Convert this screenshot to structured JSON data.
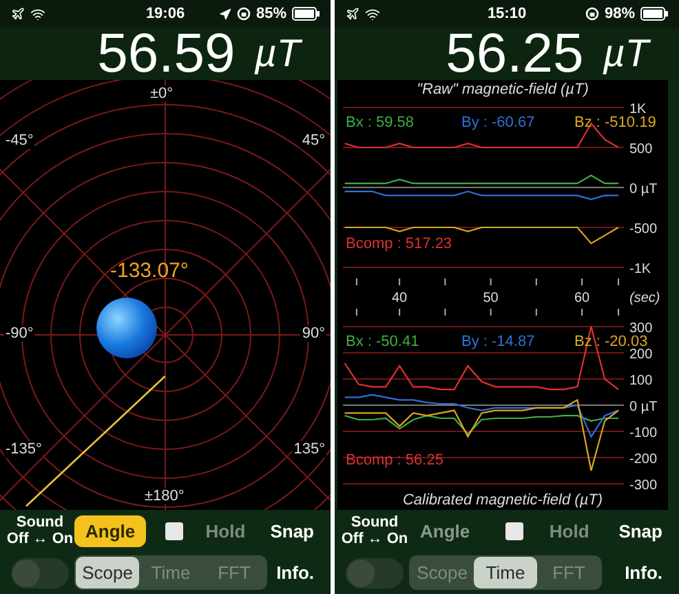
{
  "phones": [
    {
      "status": {
        "time": "19:06",
        "battery": "85%",
        "location": true
      },
      "readout": {
        "value": "56.59",
        "unit": "µT"
      },
      "display": {
        "kind": "compass",
        "labels": [
          "±0°",
          "-45°",
          "45°",
          "-90°",
          "90°",
          "-135°",
          "135°",
          "±180°"
        ],
        "heading": "-133.07°"
      },
      "controls": {
        "sound_title": "Sound",
        "sound_hint": "Off ↔ On",
        "sound_on": false,
        "buttons": [
          {
            "kind": "toggle",
            "label": "Angle",
            "selected": true
          },
          {
            "kind": "checkbox",
            "checked": false
          },
          {
            "kind": "text",
            "label": "Hold",
            "disabled": true
          },
          {
            "kind": "text",
            "label": "Snap",
            "disabled": false
          }
        ],
        "modes": [
          {
            "label": "Scope",
            "selected": true
          },
          {
            "label": "Time",
            "selected": false
          },
          {
            "label": "FFT",
            "selected": false
          }
        ],
        "info": "Info."
      }
    },
    {
      "status": {
        "time": "15:10",
        "battery": "98%",
        "location": false
      },
      "readout": {
        "value": "56.25",
        "unit": "µT"
      },
      "display": {
        "kind": "scope",
        "title_top": "\"Raw\" magnetic-field (µT)",
        "title_bottom": "Calibrated magnetic-field (µT)",
        "raw": {
          "readouts": [
            {
              "text": "Bx : 59.58",
              "color": "#3fae45"
            },
            {
              "text": "By : -60.67",
              "color": "#2f6fd8"
            },
            {
              "text": "Bz : -510.19",
              "color": "#d9a81e"
            }
          ],
          "bcomp": "Bcomp : 517.23",
          "chart_data": {
            "type": "line",
            "grid": true,
            "xlabel": "(sec)",
            "x": [
              34,
              35.5,
              37,
              38.5,
              40,
              41.5,
              43,
              44.5,
              46,
              47.5,
              49,
              50.5,
              52,
              53.5,
              55,
              56.5,
              58,
              59.5,
              61,
              62.5,
              64
            ],
            "xlim": [
              33.8,
              64.6
            ],
            "xticks": [
              40,
              50,
              60
            ],
            "ylim": [
              -1000,
              1000
            ],
            "yticks": [
              {
                "value": 1000,
                "label": "1K"
              },
              {
                "value": 500,
                "label": "500"
              },
              {
                "value": 0,
                "label": "0 µT"
              },
              {
                "value": -500,
                "label": "-500"
              },
              {
                "value": -1000,
                "label": "-1K"
              }
            ],
            "series": [
              {
                "color": "#e03030",
                "values": [
                  550,
                  500,
                  500,
                  500,
                  550,
                  500,
                  500,
                  500,
                  500,
                  550,
                  500,
                  500,
                  500,
                  500,
                  500,
                  500,
                  500,
                  500,
                  800,
                  600,
                  500
                ]
              },
              {
                "color": "#3fae45",
                "values": [
                  50,
                  50,
                  50,
                  50,
                  100,
                  50,
                  50,
                  50,
                  50,
                  50,
                  50,
                  50,
                  50,
                  50,
                  50,
                  50,
                  50,
                  50,
                  150,
                  50,
                  50
                ]
              },
              {
                "color": "#2f6fd8",
                "values": [
                  -50,
                  -50,
                  -50,
                  -100,
                  -100,
                  -100,
                  -100,
                  -100,
                  -100,
                  -50,
                  -100,
                  -100,
                  -100,
                  -100,
                  -100,
                  -100,
                  -100,
                  -100,
                  -150,
                  -100,
                  -100
                ]
              },
              {
                "color": "#d9a81e",
                "values": [
                  -500,
                  -500,
                  -500,
                  -500,
                  -550,
                  -500,
                  -500,
                  -500,
                  -500,
                  -550,
                  -500,
                  -500,
                  -500,
                  -500,
                  -500,
                  -500,
                  -500,
                  -500,
                  -700,
                  -600,
                  -500
                ]
              }
            ]
          }
        },
        "calibrated": {
          "readouts": [
            {
              "text": "Bx : -50.41",
              "color": "#3fae45"
            },
            {
              "text": "By : -14.87",
              "color": "#2f6fd8"
            },
            {
              "text": "Bz : -20.03",
              "color": "#d9a81e"
            }
          ],
          "bcomp": "Bcomp : 56.25",
          "chart_data": {
            "type": "line",
            "grid": true,
            "x": [
              34,
              35.5,
              37,
              38.5,
              40,
              41.5,
              43,
              44.5,
              46,
              47.5,
              49,
              50.5,
              52,
              53.5,
              55,
              56.5,
              58,
              59.5,
              61,
              62.5,
              64
            ],
            "xlim": [
              33.8,
              64.6
            ],
            "ylim": [
              -300,
              300
            ],
            "yticks": [
              {
                "value": 300,
                "label": "300"
              },
              {
                "value": 200,
                "label": "200"
              },
              {
                "value": 100,
                "label": "100"
              },
              {
                "value": 0,
                "label": "0 µT"
              },
              {
                "value": -100,
                "label": "-100"
              },
              {
                "value": -200,
                "label": "-200"
              },
              {
                "value": -300,
                "label": "-300"
              }
            ],
            "series": [
              {
                "color": "#e03030",
                "values": [
                  160,
                  80,
                  70,
                  70,
                  150,
                  70,
                  70,
                  60,
                  60,
                  150,
                  90,
                  70,
                  70,
                  70,
                  70,
                  60,
                  60,
                  70,
                  300,
                  100,
                  60
                ]
              },
              {
                "color": "#3fae45",
                "values": [
                  -40,
                  -55,
                  -55,
                  -50,
                  -90,
                  -55,
                  -40,
                  -50,
                  -50,
                  -110,
                  -55,
                  -50,
                  -50,
                  -50,
                  -45,
                  -45,
                  -40,
                  -40,
                  -60,
                  -50,
                  -50
                ]
              },
              {
                "color": "#2f6fd8",
                "values": [
                  30,
                  30,
                  40,
                  30,
                  20,
                  20,
                  10,
                  5,
                  5,
                  -10,
                  -20,
                  -10,
                  -10,
                  -10,
                  -10,
                  -10,
                  -10,
                  0,
                  -120,
                  -40,
                  -20
                ]
              },
              {
                "color": "#d9a81e",
                "values": [
                  -30,
                  -30,
                  -30,
                  -30,
                  -80,
                  -30,
                  -40,
                  -30,
                  -20,
                  -120,
                  -30,
                  -20,
                  -20,
                  -20,
                  -10,
                  -10,
                  -10,
                  20,
                  -250,
                  -60,
                  -20
                ]
              }
            ]
          }
        }
      },
      "controls": {
        "sound_title": "Sound",
        "sound_hint": "Off ↔ On",
        "sound_on": false,
        "buttons": [
          {
            "kind": "toggle",
            "label": "Angle",
            "selected": false
          },
          {
            "kind": "checkbox",
            "checked": false
          },
          {
            "kind": "text",
            "label": "Hold",
            "disabled": true
          },
          {
            "kind": "text",
            "label": "Snap",
            "disabled": false
          }
        ],
        "modes": [
          {
            "label": "Scope",
            "selected": false
          },
          {
            "label": "Time",
            "selected": true
          },
          {
            "label": "FFT",
            "selected": false
          }
        ],
        "info": "Info."
      }
    }
  ]
}
